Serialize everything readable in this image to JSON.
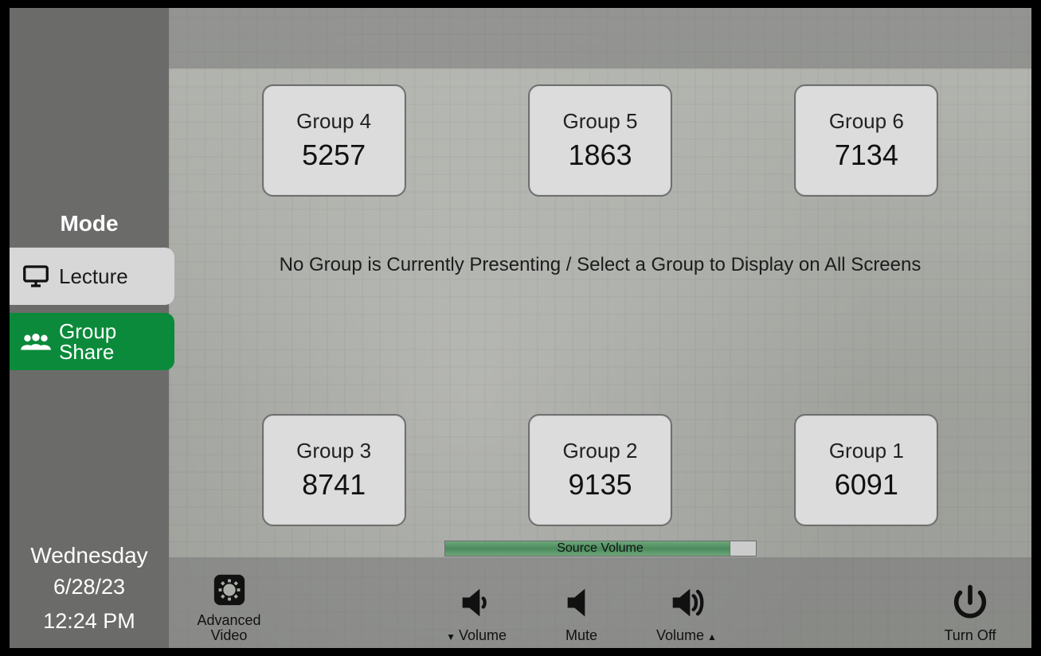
{
  "sidebar": {
    "mode_header": "Mode",
    "lecture_label": "Lecture",
    "groupshare_line1": "Group",
    "groupshare_line2": "Share",
    "day": "Wednesday",
    "date": "6/28/23",
    "time": "12:24 PM"
  },
  "main": {
    "center_message": "No Group is Currently Presenting / Select a Group to Display on All Screens",
    "volume_label": "Source Volume",
    "volume_percent": 92,
    "groups_top": [
      {
        "label": "Group 4",
        "code": "5257"
      },
      {
        "label": "Group 5",
        "code": "1863"
      },
      {
        "label": "Group 6",
        "code": "7134"
      }
    ],
    "groups_bottom": [
      {
        "label": "Group 3",
        "code": "8741"
      },
      {
        "label": "Group 2",
        "code": "9135"
      },
      {
        "label": "Group 1",
        "code": "6091"
      }
    ]
  },
  "dock": {
    "advanced_video_line1": "Advanced",
    "advanced_video_line2": "Video",
    "volume_down": "Volume",
    "mute": "Mute",
    "volume_up": "Volume",
    "turn_off": "Turn Off"
  },
  "colors": {
    "accent_green": "#0a8a3a",
    "tile_border": "#6f6f6f"
  }
}
